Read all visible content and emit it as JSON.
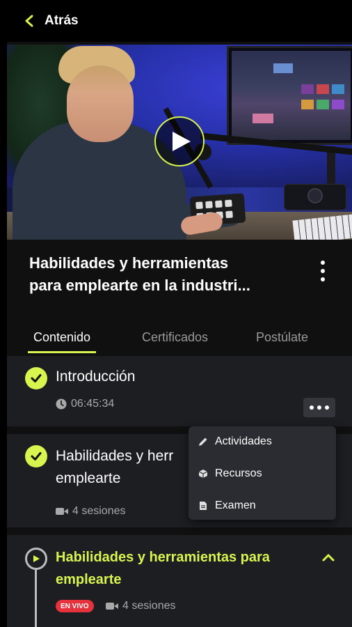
{
  "header": {
    "back_label": "Atrás"
  },
  "video": {
    "play_icon": "play-icon"
  },
  "course": {
    "title_line1": "Habilidades y herramientas",
    "title_line2": "para emplearte en la industri..."
  },
  "tabs": [
    {
      "label": "Contenido",
      "active": true
    },
    {
      "label": "Certificados",
      "active": false
    },
    {
      "label": "Postúlate",
      "active": false
    }
  ],
  "modules": [
    {
      "title": "Introducción",
      "meta": "06:45:34",
      "status": "completed"
    },
    {
      "title_line1": "Habilidades y herr",
      "title_line2": "emplearte",
      "meta": "4 sesiones",
      "status": "completed"
    },
    {
      "title_line1": "Habilidades y herramientas para",
      "title_line2": "emplearte",
      "badge": "EN VIVO",
      "meta": "4 sesiones",
      "status": "in-progress"
    }
  ],
  "menu": {
    "items": [
      {
        "label": "Actividades",
        "icon": "pencil-icon"
      },
      {
        "label": "Recursos",
        "icon": "cube-icon"
      },
      {
        "label": "Examen",
        "icon": "document-icon"
      }
    ]
  },
  "colors": {
    "accent": "#d7f44f",
    "live": "#e5323c",
    "card": "#1c1e21",
    "background": "#101010"
  }
}
